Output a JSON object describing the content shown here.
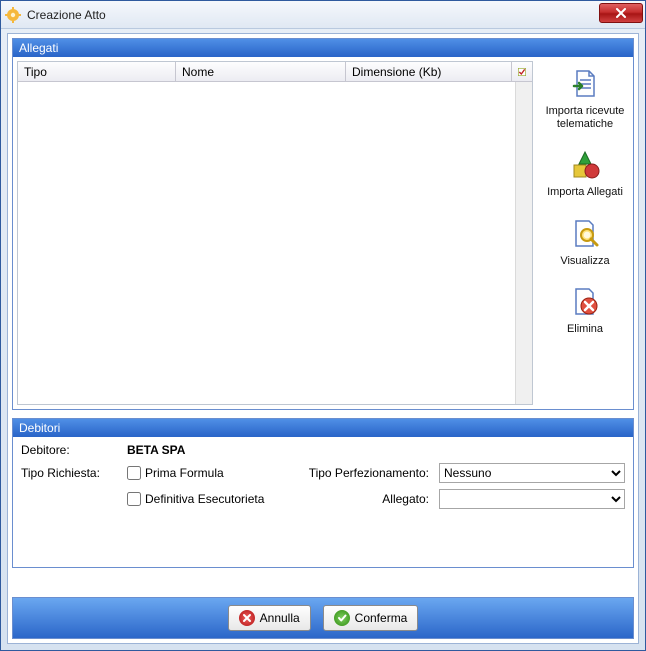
{
  "window": {
    "title": "Creazione Atto"
  },
  "allegati": {
    "header": "Allegati",
    "columns": {
      "tipo": "Tipo",
      "nome": "Nome",
      "dimensione": "Dimensione (Kb)"
    },
    "rows": [],
    "actions": {
      "importa_ricevute": "Importa ricevute telematiche",
      "importa_allegati": "Importa Allegati",
      "visualizza": "Visualizza",
      "elimina": "Elimina"
    }
  },
  "debitori": {
    "header": "Debitori",
    "labels": {
      "debitore": "Debitore:",
      "tipo_richiesta": "Tipo Richiesta:",
      "prima_formula": "Prima Formula",
      "definitiva": "Definitiva Esecutorieta",
      "tipo_perfezionamento": "Tipo Perfezionamento:",
      "allegato": "Allegato:"
    },
    "debitore_value": "BETA SPA",
    "prima_formula_checked": false,
    "definitiva_checked": false,
    "tipo_perfezionamento_selected": "Nessuno",
    "tipo_perfezionamento_options": [
      "Nessuno"
    ],
    "allegato_selected": "",
    "allegato_options": [
      ""
    ]
  },
  "footer": {
    "annulla": "Annulla",
    "conferma": "Conferma"
  },
  "colors": {
    "panel_header_bg": "#2b66c9",
    "accent": "#2b66c9"
  }
}
